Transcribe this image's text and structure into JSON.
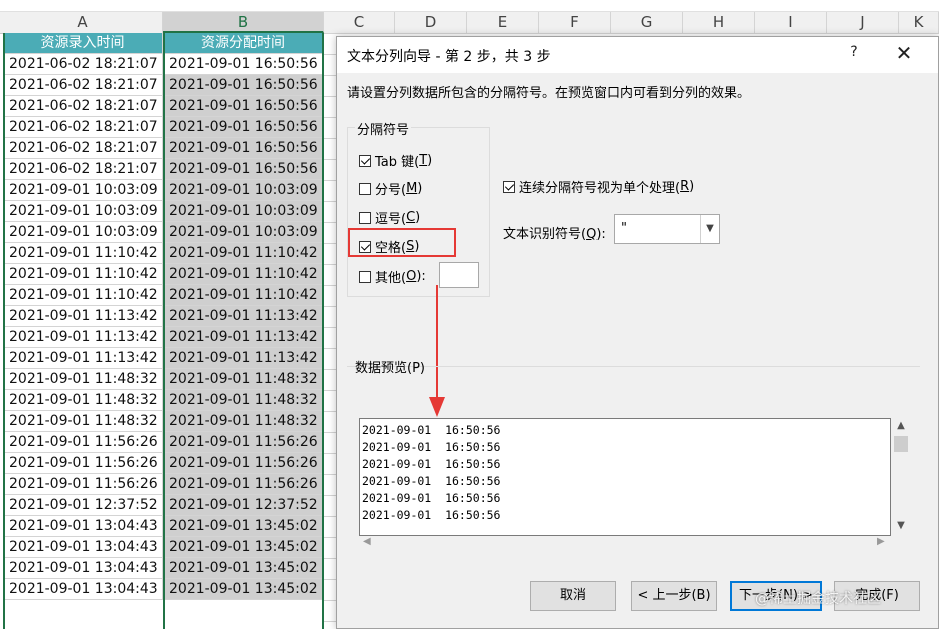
{
  "spreadsheet": {
    "columns": [
      "A",
      "B",
      "C",
      "D",
      "E",
      "F",
      "G",
      "H",
      "I",
      "J",
      "K"
    ],
    "header_row": {
      "a": "资源录入时间",
      "b": "资源分配时间"
    },
    "rows": [
      {
        "a": "2021-06-02 18:21:07",
        "b": "2021-09-01 16:50:56"
      },
      {
        "a": "2021-06-02 18:21:07",
        "b": "2021-09-01 16:50:56"
      },
      {
        "a": "2021-06-02 18:21:07",
        "b": "2021-09-01 16:50:56"
      },
      {
        "a": "2021-06-02 18:21:07",
        "b": "2021-09-01 16:50:56"
      },
      {
        "a": "2021-06-02 18:21:07",
        "b": "2021-09-01 16:50:56"
      },
      {
        "a": "2021-06-02 18:21:07",
        "b": "2021-09-01 16:50:56"
      },
      {
        "a": "2021-09-01 10:03:09",
        "b": "2021-09-01 10:03:09"
      },
      {
        "a": "2021-09-01 10:03:09",
        "b": "2021-09-01 10:03:09"
      },
      {
        "a": "2021-09-01 10:03:09",
        "b": "2021-09-01 10:03:09"
      },
      {
        "a": "2021-09-01 11:10:42",
        "b": "2021-09-01 11:10:42"
      },
      {
        "a": "2021-09-01 11:10:42",
        "b": "2021-09-01 11:10:42"
      },
      {
        "a": "2021-09-01 11:10:42",
        "b": "2021-09-01 11:10:42"
      },
      {
        "a": "2021-09-01 11:13:42",
        "b": "2021-09-01 11:13:42"
      },
      {
        "a": "2021-09-01 11:13:42",
        "b": "2021-09-01 11:13:42"
      },
      {
        "a": "2021-09-01 11:13:42",
        "b": "2021-09-01 11:13:42"
      },
      {
        "a": "2021-09-01 11:48:32",
        "b": "2021-09-01 11:48:32"
      },
      {
        "a": "2021-09-01 11:48:32",
        "b": "2021-09-01 11:48:32"
      },
      {
        "a": "2021-09-01 11:48:32",
        "b": "2021-09-01 11:48:32"
      },
      {
        "a": "2021-09-01 11:56:26",
        "b": "2021-09-01 11:56:26"
      },
      {
        "a": "2021-09-01 11:56:26",
        "b": "2021-09-01 11:56:26"
      },
      {
        "a": "2021-09-01 11:56:26",
        "b": "2021-09-01 11:56:26"
      },
      {
        "a": "2021-09-01 12:37:52",
        "b": "2021-09-01 12:37:52"
      },
      {
        "a": "2021-09-01 13:04:43",
        "b": "2021-09-01 13:45:02"
      },
      {
        "a": "2021-09-01 13:04:43",
        "b": "2021-09-01 13:45:02"
      },
      {
        "a": "2021-09-01 13:04:43",
        "b": "2021-09-01 13:45:02"
      },
      {
        "a": "2021-09-01 13:04:43",
        "b": "2021-09-01 13:45:02"
      }
    ]
  },
  "dialog": {
    "title": "文本分列向导 - 第 2 步，共 3 步",
    "help": "?",
    "close": "✕",
    "instruction": "请设置分列数据所包含的分隔符号。在预览窗口内可看到分列的效果。",
    "delimiter_group_label": "分隔符号",
    "delimiters": [
      {
        "label": "Tab 键(",
        "key": "T",
        "tail": ")",
        "checked": true
      },
      {
        "label": "分号(",
        "key": "M",
        "tail": ")",
        "checked": false
      },
      {
        "label": "逗号(",
        "key": "C",
        "tail": ")",
        "checked": false
      },
      {
        "label": "空格(",
        "key": "S",
        "tail": ")",
        "checked": true
      },
      {
        "label": "其他(",
        "key": "O",
        "tail": "):",
        "checked": false
      }
    ],
    "consecutive": {
      "label": "连续分隔符号视为单个处理(",
      "key": "R",
      "tail": ")",
      "checked": true
    },
    "qualifier": {
      "label": "文本识别符号(",
      "key": "Q",
      "tail": "):",
      "value": "\""
    },
    "preview_label": "数据预览(P)",
    "preview_lines": [
      "2021-09-01  16:50:56",
      "2021-09-01  16:50:56",
      "2021-09-01  16:50:56",
      "2021-09-01  16:50:56",
      "2021-09-01  16:50:56",
      "2021-09-01  16:50:56"
    ],
    "buttons": {
      "cancel": "取消",
      "back": "< 上一步(B)",
      "next": "下一步(N) >",
      "finish": "完成(F)"
    }
  },
  "watermark": "@稀土掘金技术社区",
  "colors": {
    "accent": "#217346",
    "header_fill": "#4bacb6",
    "annotation": "#e53935"
  }
}
